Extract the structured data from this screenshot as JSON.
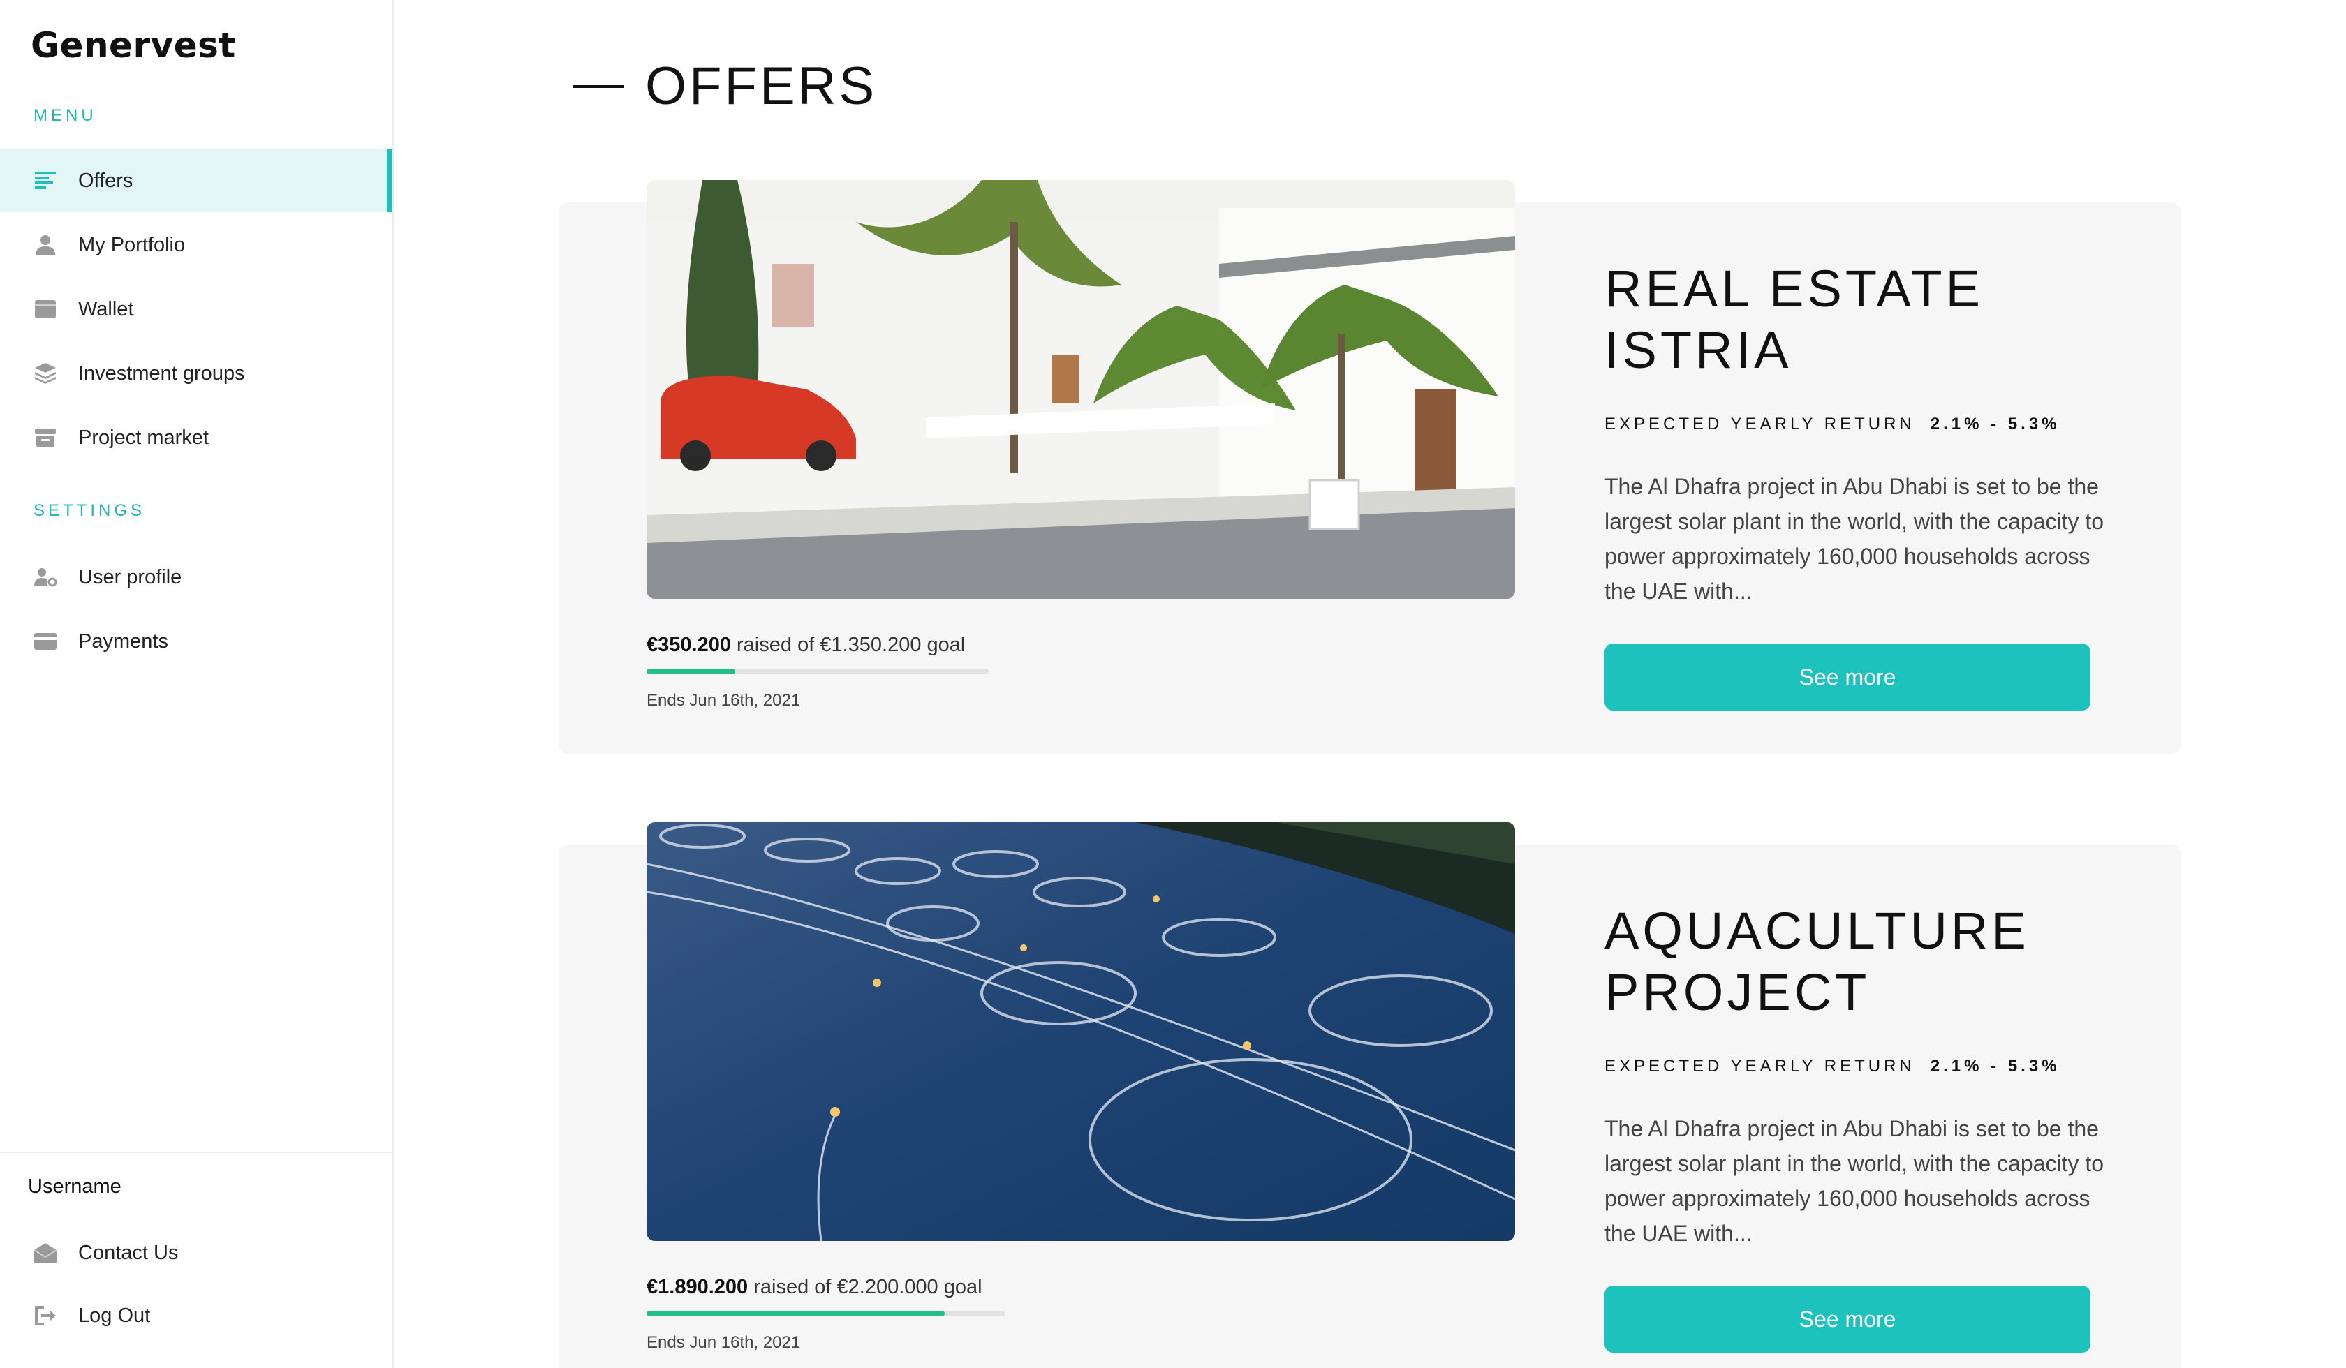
{
  "app": {
    "logo": "Genervest"
  },
  "sidebar": {
    "menu_label": "MENU",
    "menu_items": [
      {
        "label": "Offers",
        "icon": "list-icon",
        "active": true
      },
      {
        "label": "My Portfolio",
        "icon": "user-icon"
      },
      {
        "label": "Wallet",
        "icon": "wallet-icon"
      },
      {
        "label": "Investment groups",
        "icon": "layers-icon"
      },
      {
        "label": "Project market",
        "icon": "store-icon"
      }
    ],
    "settings_label": "SETTINGS",
    "settings_items": [
      {
        "label": "User profile",
        "icon": "user-settings-icon"
      },
      {
        "label": "Payments",
        "icon": "credit-card-icon"
      }
    ],
    "username": "Username",
    "footer_items": [
      {
        "label": "Contact Us",
        "icon": "mail-icon"
      },
      {
        "label": "Log Out",
        "icon": "logout-icon"
      }
    ]
  },
  "main": {
    "title": "OFFERS",
    "offers": [
      {
        "title_line1": "REAL ESTATE",
        "title_line2": "ISTRIA",
        "return_label": "EXPECTED YEARLY RETURN",
        "return_value": "2.1% - 5.3%",
        "description": "The Al Dhafra project in Abu Dhabi is set to be the largest solar plant in the world, with the capacity to power approximately 160,000 households across the UAE with...",
        "raised_amount": "€350.200",
        "raised_text": " raised of €1.350.200 goal",
        "progress": 0.26,
        "ends": "Ends Jun 16th, 2021",
        "button": "See more"
      },
      {
        "title_line1": "AQUACULTURE",
        "title_line2": "PROJECT",
        "return_label": "EXPECTED YEARLY RETURN",
        "return_value": "2.1% - 5.3%",
        "description": "The Al Dhafra project in Abu Dhabi is set to be the largest solar plant in the world, with the capacity to power approximately 160,000 households across the UAE with...",
        "raised_amount": "€1.890.200",
        "raised_text": " raised of €2.200.000 goal",
        "progress": 0.83,
        "ends": "Ends Jun 16th, 2021",
        "button": "See more"
      }
    ]
  },
  "colors": {
    "accent": "#1ec2bd",
    "active_bg": "#e2f6f6",
    "progress": "#21c08a"
  }
}
